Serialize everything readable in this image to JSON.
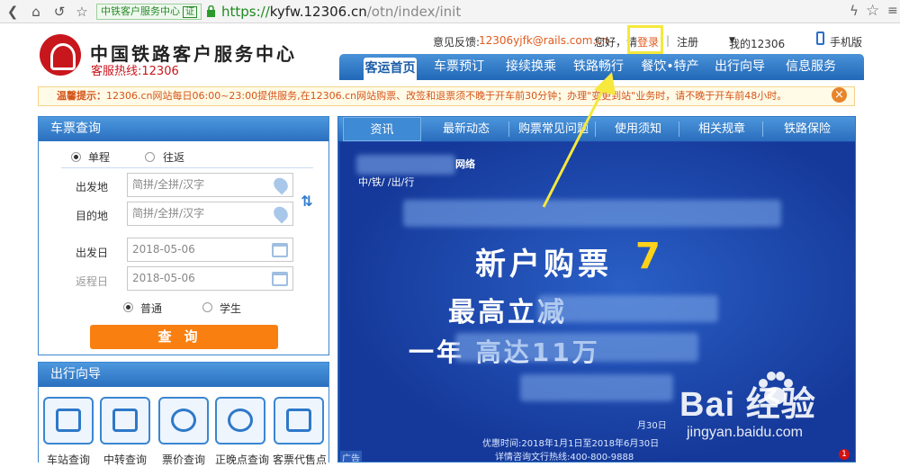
{
  "browser": {
    "site_tag": "中铁客户服务中心",
    "cert": "证",
    "url_proto": "https://",
    "url_host": "kyfw.12306.cn",
    "url_path": "/otn/index/init"
  },
  "header": {
    "brand": "中国铁路客户服务中心",
    "hotline": "客服热线:12306",
    "feedback_label": "意见反馈:",
    "feedback_email": "12306yjfk@rails.com.cn",
    "greeting": "您好，请",
    "login": "登录",
    "divider": "|",
    "register": "注册",
    "my12306": "我的12306",
    "mobile": "手机版"
  },
  "nav": [
    "客运首页",
    "车票预订",
    "接续换乘",
    "铁路畅行",
    "餐饮•特产",
    "出行向导",
    "信息服务"
  ],
  "notice": {
    "prefix": "温馨提示：",
    "text": "12306.cn网站每日06:00~23:00提供服务,在12306.cn网站购票、改签和退票须不晚于开车前30分钟；办理\"变更到站\"业务时，请不晚于开车前48小时。"
  },
  "ticket": {
    "title": "车票查询",
    "one_way": "单程",
    "round_trip": "往返",
    "from_label": "出发地",
    "to_label": "目的地",
    "from_placeholder": "简拼/全拼/汉字",
    "to_placeholder": "简拼/全拼/汉字",
    "date_label": "出发日",
    "return_label": "返程日",
    "date_value": "2018-05-06",
    "return_value": "2018-05-06",
    "normal": "普通",
    "student": "学生",
    "search": "查询"
  },
  "guide": {
    "title": "出行向导",
    "items": [
      "车站查询",
      "中转查询",
      "票价查询",
      "正晚点查询",
      "客票代售点"
    ]
  },
  "info": {
    "tabs": [
      "资讯",
      "最新动态",
      "购票常见问题",
      "使用须知",
      "相关规章",
      "铁路保险"
    ],
    "banner": {
      "logo_text": "网络",
      "subtitle": "中/铁/ /出/行",
      "title_line": "新户购票",
      "big_line": "最高立减",
      "line4": "一年 高达11万",
      "date_end": "月30日",
      "validity": "优惠时间:2018年1月1日至2018年6月30日",
      "hotline": "详情咨询文行热线:400-800-9888",
      "ad": "广告",
      "badge": "1"
    }
  },
  "watermark": {
    "brand": "Bai 经验",
    "url": "jingyan.baidu.com"
  }
}
